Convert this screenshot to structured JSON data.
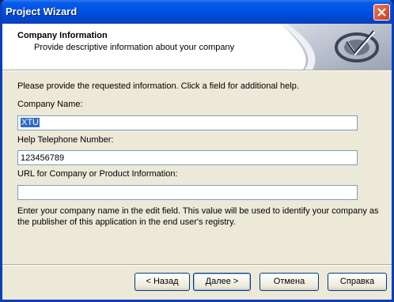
{
  "window": {
    "title": "Project Wizard"
  },
  "header": {
    "title": "Company Information",
    "subtitle": "Provide descriptive information about your company"
  },
  "body": {
    "instruction": "Please provide the requested information. Click a field for additional help.",
    "fields": [
      {
        "label": "Company Name:",
        "value": "XTU"
      },
      {
        "label": "Help Telephone Number:",
        "value": "123456789"
      },
      {
        "label": "URL for Company or Product Information:",
        "value": ""
      }
    ],
    "help_text": "Enter your company name in the edit field. This value will be used to identify your company as the publisher of this application in the end user's registry."
  },
  "buttons": {
    "back": "< Назад",
    "next": "Далее >",
    "cancel": "Отмена",
    "help": "Справка"
  }
}
